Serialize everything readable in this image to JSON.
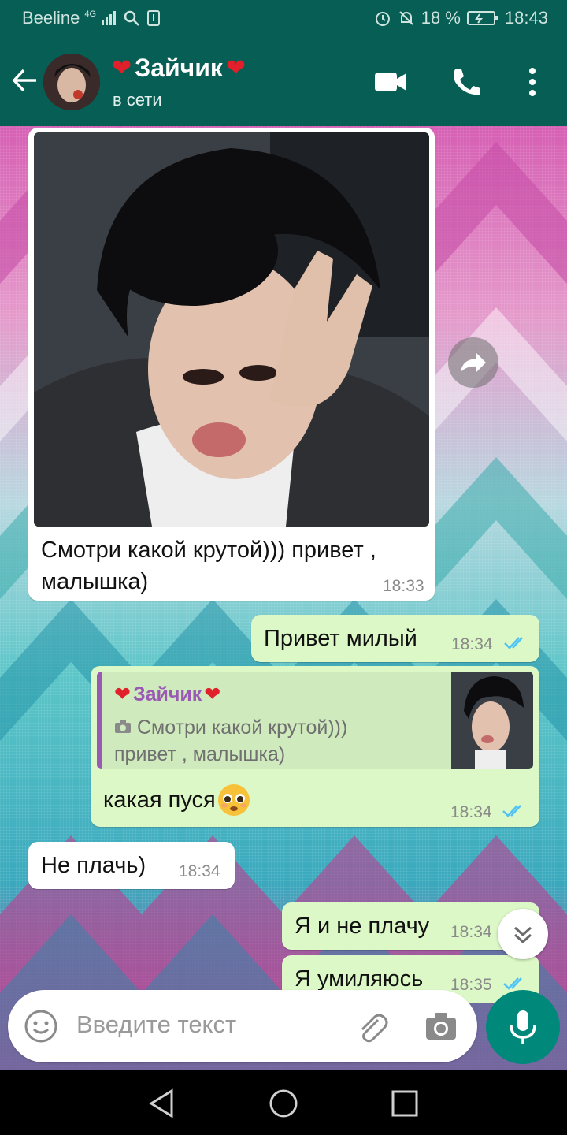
{
  "status_bar": {
    "carrier": "Beeline",
    "network": "4G",
    "battery": "18 %",
    "time": "18:43"
  },
  "header": {
    "contact_name": "Зайчик",
    "contact_status": "в сети",
    "icons": [
      "arrow-left-icon",
      "video-call-icon",
      "phone-icon",
      "more-vert-icon"
    ]
  },
  "messages": [
    {
      "direction": "in",
      "type": "image",
      "text_line1": "Смотри какой крутой))) привет ,",
      "text_line2": "малышка)",
      "time": "18:33"
    },
    {
      "direction": "out",
      "text": "Привет милый",
      "time": "18:34",
      "status": "read"
    },
    {
      "direction": "out",
      "reply": {
        "author": "Зайчик",
        "line1": "Смотри какой крутой)))",
        "line2": "привет , малышка)"
      },
      "text": "какая пуся",
      "emoji": "pleading-face",
      "time": "18:34",
      "status": "read"
    },
    {
      "direction": "in",
      "text": "Не плачь)",
      "time": "18:34"
    },
    {
      "direction": "out",
      "text": "Я и не плачу",
      "time": "18:34",
      "status": "read"
    },
    {
      "direction": "out",
      "text": "Я умиляюсь",
      "time": "18:35",
      "status": "read"
    }
  ],
  "input": {
    "placeholder": "Введите текст"
  },
  "colors": {
    "header": "#075e54",
    "outgoing_bubble": "#dcf8c6",
    "incoming_bubble": "#ffffff",
    "read_ticks": "#4fc3f7",
    "mic": "#00897b",
    "reply_accent": "#9b59b6"
  }
}
